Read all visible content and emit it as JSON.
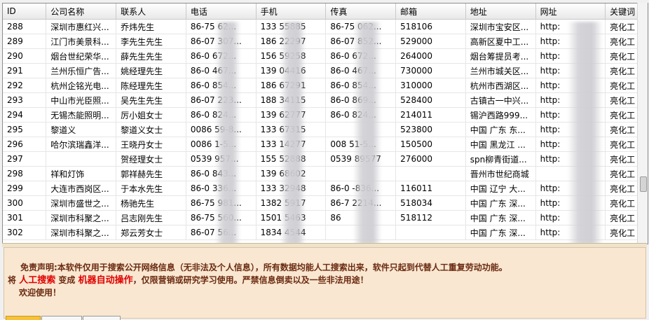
{
  "table": {
    "columns": [
      "ID",
      "公司名称",
      "联系人",
      "电话",
      "手机",
      "传真",
      "邮箱",
      "地址",
      "网址",
      "关键词"
    ],
    "rows": [
      [
        "288",
        "深圳市惠红兴...",
        "乔炜先生",
        "86-75    62...",
        "133     55885",
        "86-75    062...",
        "518106",
        "深圳市宝安区...",
        "http:",
        "亮化工"
      ],
      [
        "289",
        "江门市美景科...",
        "李先生先生",
        "86-07    307...",
        "186     22297",
        "86-07    852...",
        "529000",
        "高新区夏中工...",
        "http:",
        "亮化工"
      ],
      [
        "290",
        "烟台世纪荣华...",
        "薛先生先生",
        "86-0     672...",
        "156     59258",
        "86-0     672...",
        "264000",
        "烟台筹提员考...",
        "http:",
        "亮化工"
      ],
      [
        "291",
        "兰州乐恒广告...",
        "姚经理先生",
        "86-0     467...",
        "139     04416",
        "86-0     467...",
        "730000",
        "兰州市城关区...",
        "http:",
        "亮化工"
      ],
      [
        "292",
        "杭州企铭光电...",
        "陈经理先生",
        "86-0     854...",
        "186     67291",
        "86-0     854...",
        "310000",
        "杭州市西湖区...",
        "http:",
        "亮化工"
      ],
      [
        "293",
        "中山市光臣照...",
        "吴先生先生",
        "86-07    223...",
        "188     34115",
        "86-0     869...",
        "528400",
        "古镇古一中兴...",
        "http:",
        "亮化工"
      ],
      [
        "294",
        "无锡杰能照明...",
        "厉小姐女士",
        "86-0     824...",
        "139     62777",
        "86-0     824...",
        "214011",
        "锡沪西路999...",
        "http:",
        "亮化工"
      ],
      [
        "295",
        "黎道义",
        "黎道义女士",
        "0086     59-8...",
        "133     67315",
        "",
        "523800",
        "中国 广东 东...",
        "http:",
        "亮化工"
      ],
      [
        "296",
        "哈尔滨瑞鑫洋...",
        "王晓丹女士",
        "0086     1-5...",
        "133     14277",
        "008      51-5...",
        "150500",
        "中国 黑龙江 ...",
        "http:",
        "亮化工"
      ],
      [
        "297",
        "",
        "贺经理女士",
        "0539     957...",
        "155     52888",
        "0539     89577",
        "276000",
        "spn柳青街道...",
        "http:",
        "亮化工"
      ],
      [
        "298",
        "祥和灯饰",
        "郭祥赫先生",
        "86-0     843...",
        "139     68602",
        "",
        "",
        "晋州市世纪商城",
        "",
        "亮化工"
      ],
      [
        "299",
        "大连市西岗区...",
        "于本水先生",
        "86-0     336...",
        "133     32948",
        "86-0     -836...",
        "116011",
        "中国 辽宁 大...",
        "http:",
        "亮化工"
      ],
      [
        "300",
        "深圳市盛世之...",
        "杨驰先生",
        "86-75    981...",
        "1382     5917",
        "86-7     2214...",
        "518034",
        "中国 广东 深...",
        "http:",
        "亮化工"
      ],
      [
        "301",
        "深圳市科聚之...",
        "吕志刚先生",
        "86-75    560...",
        "1501     5463",
        "86",
        "518112",
        "中国 广东 深...",
        "http:",
        "亮化工"
      ],
      [
        "302",
        "深圳市科聚之...",
        "郑云芳女士",
        "86-07    56...",
        "1834     4544",
        "",
        "",
        "中国 广东 深...",
        "http:",
        "亮化工"
      ]
    ]
  },
  "notice": {
    "line1": "免责声明:本软件仅用于搜索公开网络信息（无非法及个人信息），所有数据均能人工搜索出来，软件只起到代替人工重复劳动功能。",
    "line2_prefix": "将",
    "highlight1": "人工搜索",
    "line2_mid": "变成",
    "highlight2": "机器自动操作",
    "line2_suffix": "，仅限营销或研究学习使用。严禁信息倒卖以及一些非法用途！",
    "line3": "欢迎使用！"
  }
}
